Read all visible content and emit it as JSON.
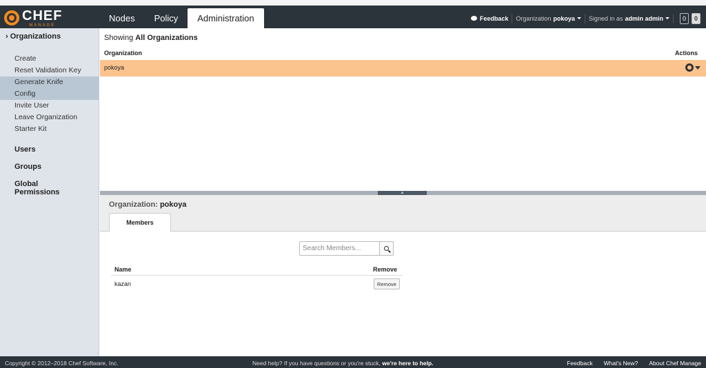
{
  "brand": {
    "name": "CHEF",
    "sub": "MANAGE",
    "accent": "#f38b20"
  },
  "nav": {
    "tabs": [
      {
        "label": "Nodes"
      },
      {
        "label": "Policy"
      },
      {
        "label": "Administration"
      }
    ]
  },
  "topright": {
    "feedback": "Feedback",
    "org_label": "Organization",
    "org_value": "pokoya",
    "signed_label": "Signed in as",
    "signed_value": "admin admin",
    "count1": "0",
    "count2": "0"
  },
  "sidebar": {
    "head": "Organizations",
    "links": [
      {
        "label": "Create"
      },
      {
        "label": "Reset Validation Key"
      },
      {
        "label": "Generate Knife Config"
      },
      {
        "label": "Invite User"
      },
      {
        "label": "Leave Organization"
      },
      {
        "label": "Starter Kit"
      }
    ],
    "sections": [
      {
        "label": "Users"
      },
      {
        "label": "Groups"
      },
      {
        "label": "Global Permissions"
      }
    ]
  },
  "main": {
    "showing_prefix": "Showing",
    "showing_value": "All Organizations",
    "col_org": "Organization",
    "col_actions": "Actions",
    "rows": [
      {
        "name": "pokoya"
      }
    ]
  },
  "panel": {
    "title_prefix": "Organization:",
    "title_value": "pokoya",
    "tab": "Members",
    "search_placeholder": "Search Members...",
    "col_name": "Name",
    "col_remove": "Remove",
    "members": [
      {
        "name": "kazan",
        "action": "Remove"
      }
    ]
  },
  "footer": {
    "copyright": "Copyright © 2012–2018 Chef Software, Inc.",
    "help_prefix": "Need help? If you have questions or you're stuck,",
    "help_link": "we're here to help.",
    "links": [
      {
        "label": "Feedback"
      },
      {
        "label": "What's New?"
      },
      {
        "label": "About Chef Manage"
      }
    ]
  }
}
